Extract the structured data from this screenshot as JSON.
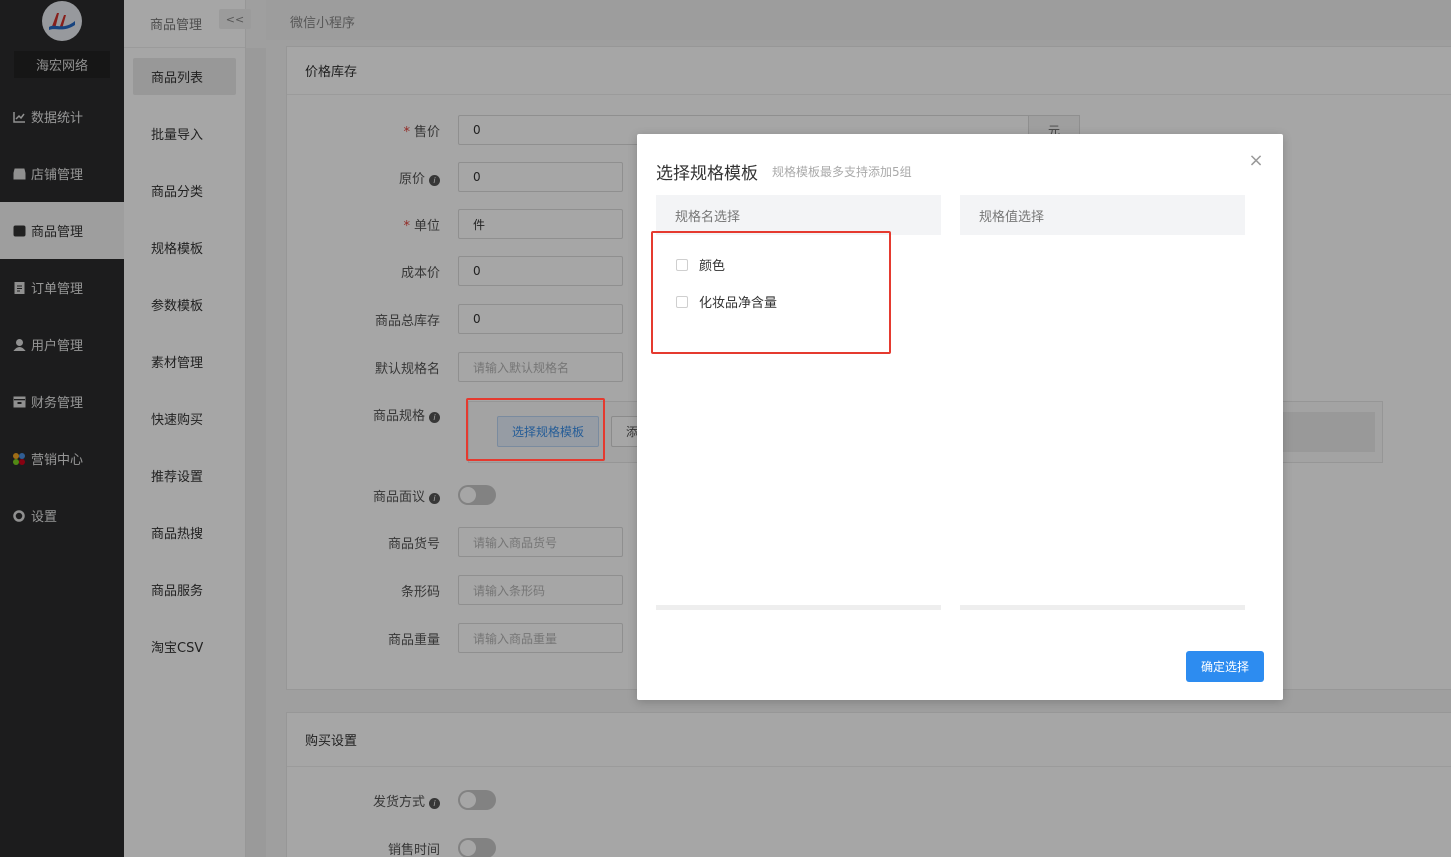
{
  "sidebar": {
    "brand": "海宏网络",
    "items": [
      {
        "label": "数据统计",
        "icon": "chart-line-icon"
      },
      {
        "label": "店铺管理",
        "icon": "store-icon"
      },
      {
        "label": "商品管理",
        "icon": "goods-icon",
        "active": true
      },
      {
        "label": "订单管理",
        "icon": "order-icon"
      },
      {
        "label": "用户管理",
        "icon": "user-icon"
      },
      {
        "label": "财务管理",
        "icon": "finance-icon"
      },
      {
        "label": "营销中心",
        "icon": "marketing-icon"
      },
      {
        "label": "设置",
        "icon": "gear-icon"
      }
    ]
  },
  "subnav": {
    "title": "商品管理",
    "collapse_label": "<<",
    "items": [
      {
        "label": "商品列表",
        "active": true
      },
      {
        "label": "批量导入"
      },
      {
        "label": "商品分类"
      },
      {
        "label": "规格模板"
      },
      {
        "label": "参数模板"
      },
      {
        "label": "素材管理"
      },
      {
        "label": "快速购买"
      },
      {
        "label": "推荐设置"
      },
      {
        "label": "商品热搜"
      },
      {
        "label": "商品服务"
      },
      {
        "label": "淘宝CSV"
      }
    ]
  },
  "topbar": {
    "title": "微信小程序"
  },
  "price_panel": {
    "title": "价格库存",
    "fields": {
      "price": {
        "label": "售价",
        "value": "0",
        "unit": "元"
      },
      "original_price": {
        "label": "原价",
        "value": "0"
      },
      "unit": {
        "label": "单位",
        "value": "件"
      },
      "cost": {
        "label": "成本价",
        "value": "0"
      },
      "stock": {
        "label": "商品总库存",
        "value": "0"
      },
      "default_spec": {
        "label": "默认规格名",
        "placeholder": "请输入默认规格名"
      },
      "spec": {
        "label": "商品规格",
        "select_btn": "选择规格模板",
        "add_btn": "添"
      },
      "negotiable": {
        "label": "商品面议"
      },
      "sku": {
        "label": "商品货号",
        "placeholder": "请输入商品货号"
      },
      "barcode": {
        "label": "条形码",
        "placeholder": "请输入条形码"
      },
      "weight": {
        "label": "商品重量",
        "placeholder": "请输入商品重量"
      }
    }
  },
  "buy_panel": {
    "title": "购买设置",
    "fields": {
      "delivery": {
        "label": "发货方式"
      },
      "sale_time": {
        "label": "销售时间"
      }
    }
  },
  "modal": {
    "title": "选择规格模板",
    "subtitle": "规格模板最多支持添加5组",
    "close": "×",
    "name_col": "规格名选择",
    "value_col": "规格值选择",
    "options": [
      {
        "label": "颜色",
        "checked": false
      },
      {
        "label": "化妆品净含量",
        "checked": false
      }
    ],
    "confirm": "确定选择"
  },
  "colors": {
    "sidebar_bg": "#2b2c2d",
    "primary": "#2d8cf0",
    "highlight_frame": "#e53a2f",
    "required": "#e0403a"
  }
}
